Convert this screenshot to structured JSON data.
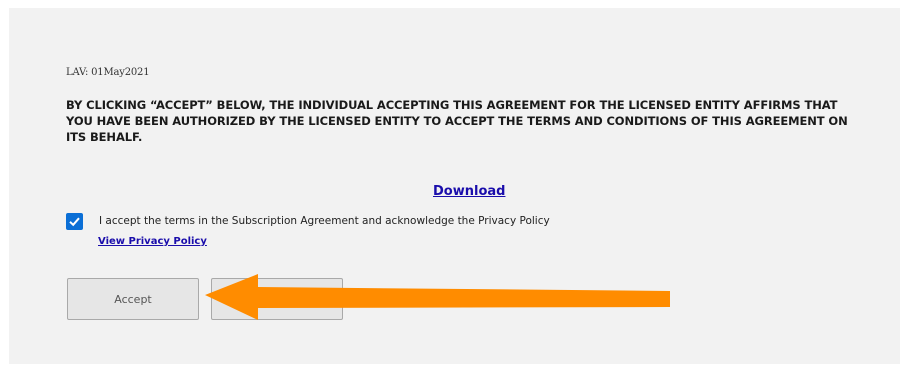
{
  "agreement": {
    "version_label": "LAV: 01May2021",
    "affirmation_text": "BY CLICKING “ACCEPT” BELOW, THE INDIVIDUAL ACCEPTING THIS AGREEMENT FOR THE LICENSED ENTITY AFFIRMS THAT YOU HAVE BEEN AUTHORIZED BY THE LICENSED ENTITY TO ACCEPT THE TERMS AND CONDITIONS OF THIS AGREEMENT ON ITS BEHALF.",
    "download_link": "Download"
  },
  "consent": {
    "checked": true,
    "label": "I accept the terms in the Subscription Agreement and acknowledge the Privacy Policy",
    "privacy_link": "View Privacy Policy"
  },
  "buttons": {
    "accept_label": "Accept",
    "decline_label": ""
  },
  "annotation": {
    "arrow_color": "#ff8c00",
    "checkbox_color": "#0b6fd6",
    "link_color": "#1a0dab"
  }
}
